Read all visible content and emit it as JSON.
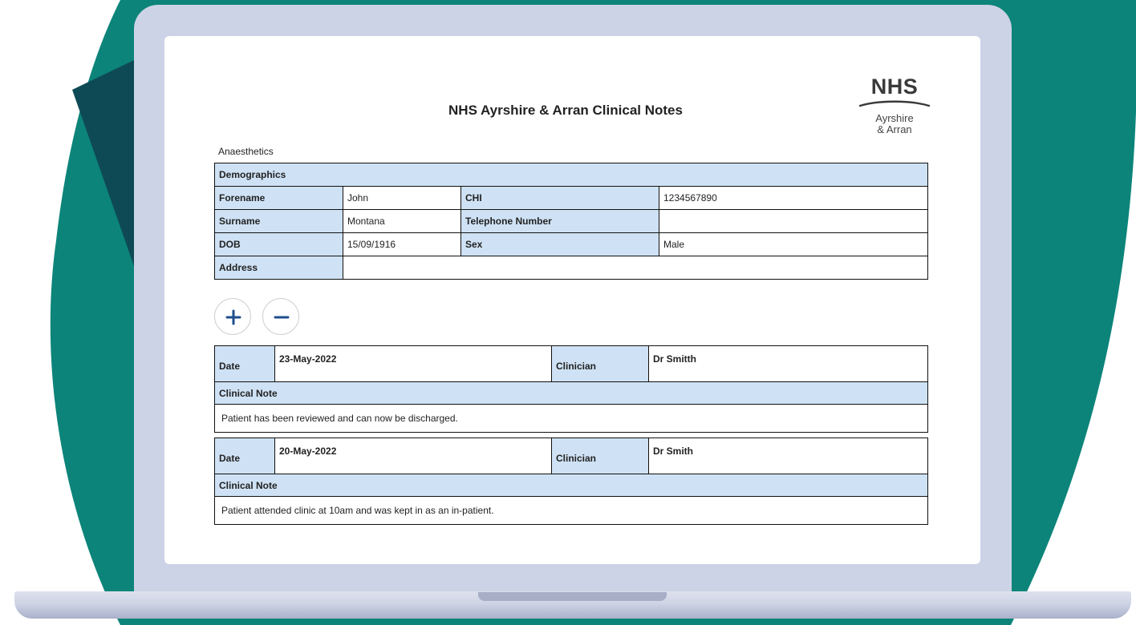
{
  "document": {
    "title": "NHS Ayrshire & Arran Clinical Notes",
    "department": "Anaesthetics",
    "logo": {
      "brand": "NHS",
      "line1": "Ayrshire",
      "line2": "& Arran"
    }
  },
  "demographics": {
    "header": "Demographics",
    "forename_label": "Forename",
    "forename": "John",
    "chi_label": "CHI",
    "chi": "1234567890",
    "surname_label": "Surname",
    "surname": "Montana",
    "telephone_label": "Telephone Number",
    "telephone": "",
    "dob_label": "DOB",
    "dob": "15/09/1916",
    "sex_label": "Sex",
    "sex": "Male",
    "address_label": "Address",
    "address": ""
  },
  "controls": {
    "expand_icon": "plus-icon",
    "collapse_icon": "minus-icon",
    "accent_color": "#1f4e8c"
  },
  "notes": [
    {
      "date_label": "Date",
      "date": "23-May-2022",
      "clinician_label": "Clinician",
      "clinician": "Dr Smitth",
      "note_label": "Clinical Note",
      "note": "Patient has been reviewed and can now be discharged."
    },
    {
      "date_label": "Date",
      "date": "20-May-2022",
      "clinician_label": "Clinician",
      "clinician": "Dr Smith",
      "note_label": "Clinical Note",
      "note": "Patient attended clinic at 10am and was kept in as an in-patient."
    }
  ],
  "colors": {
    "teal": "#0c8479",
    "dark_teal": "#0e4a55",
    "header_cell": "#cfe2f5",
    "laptop": "#cdd3e6"
  }
}
